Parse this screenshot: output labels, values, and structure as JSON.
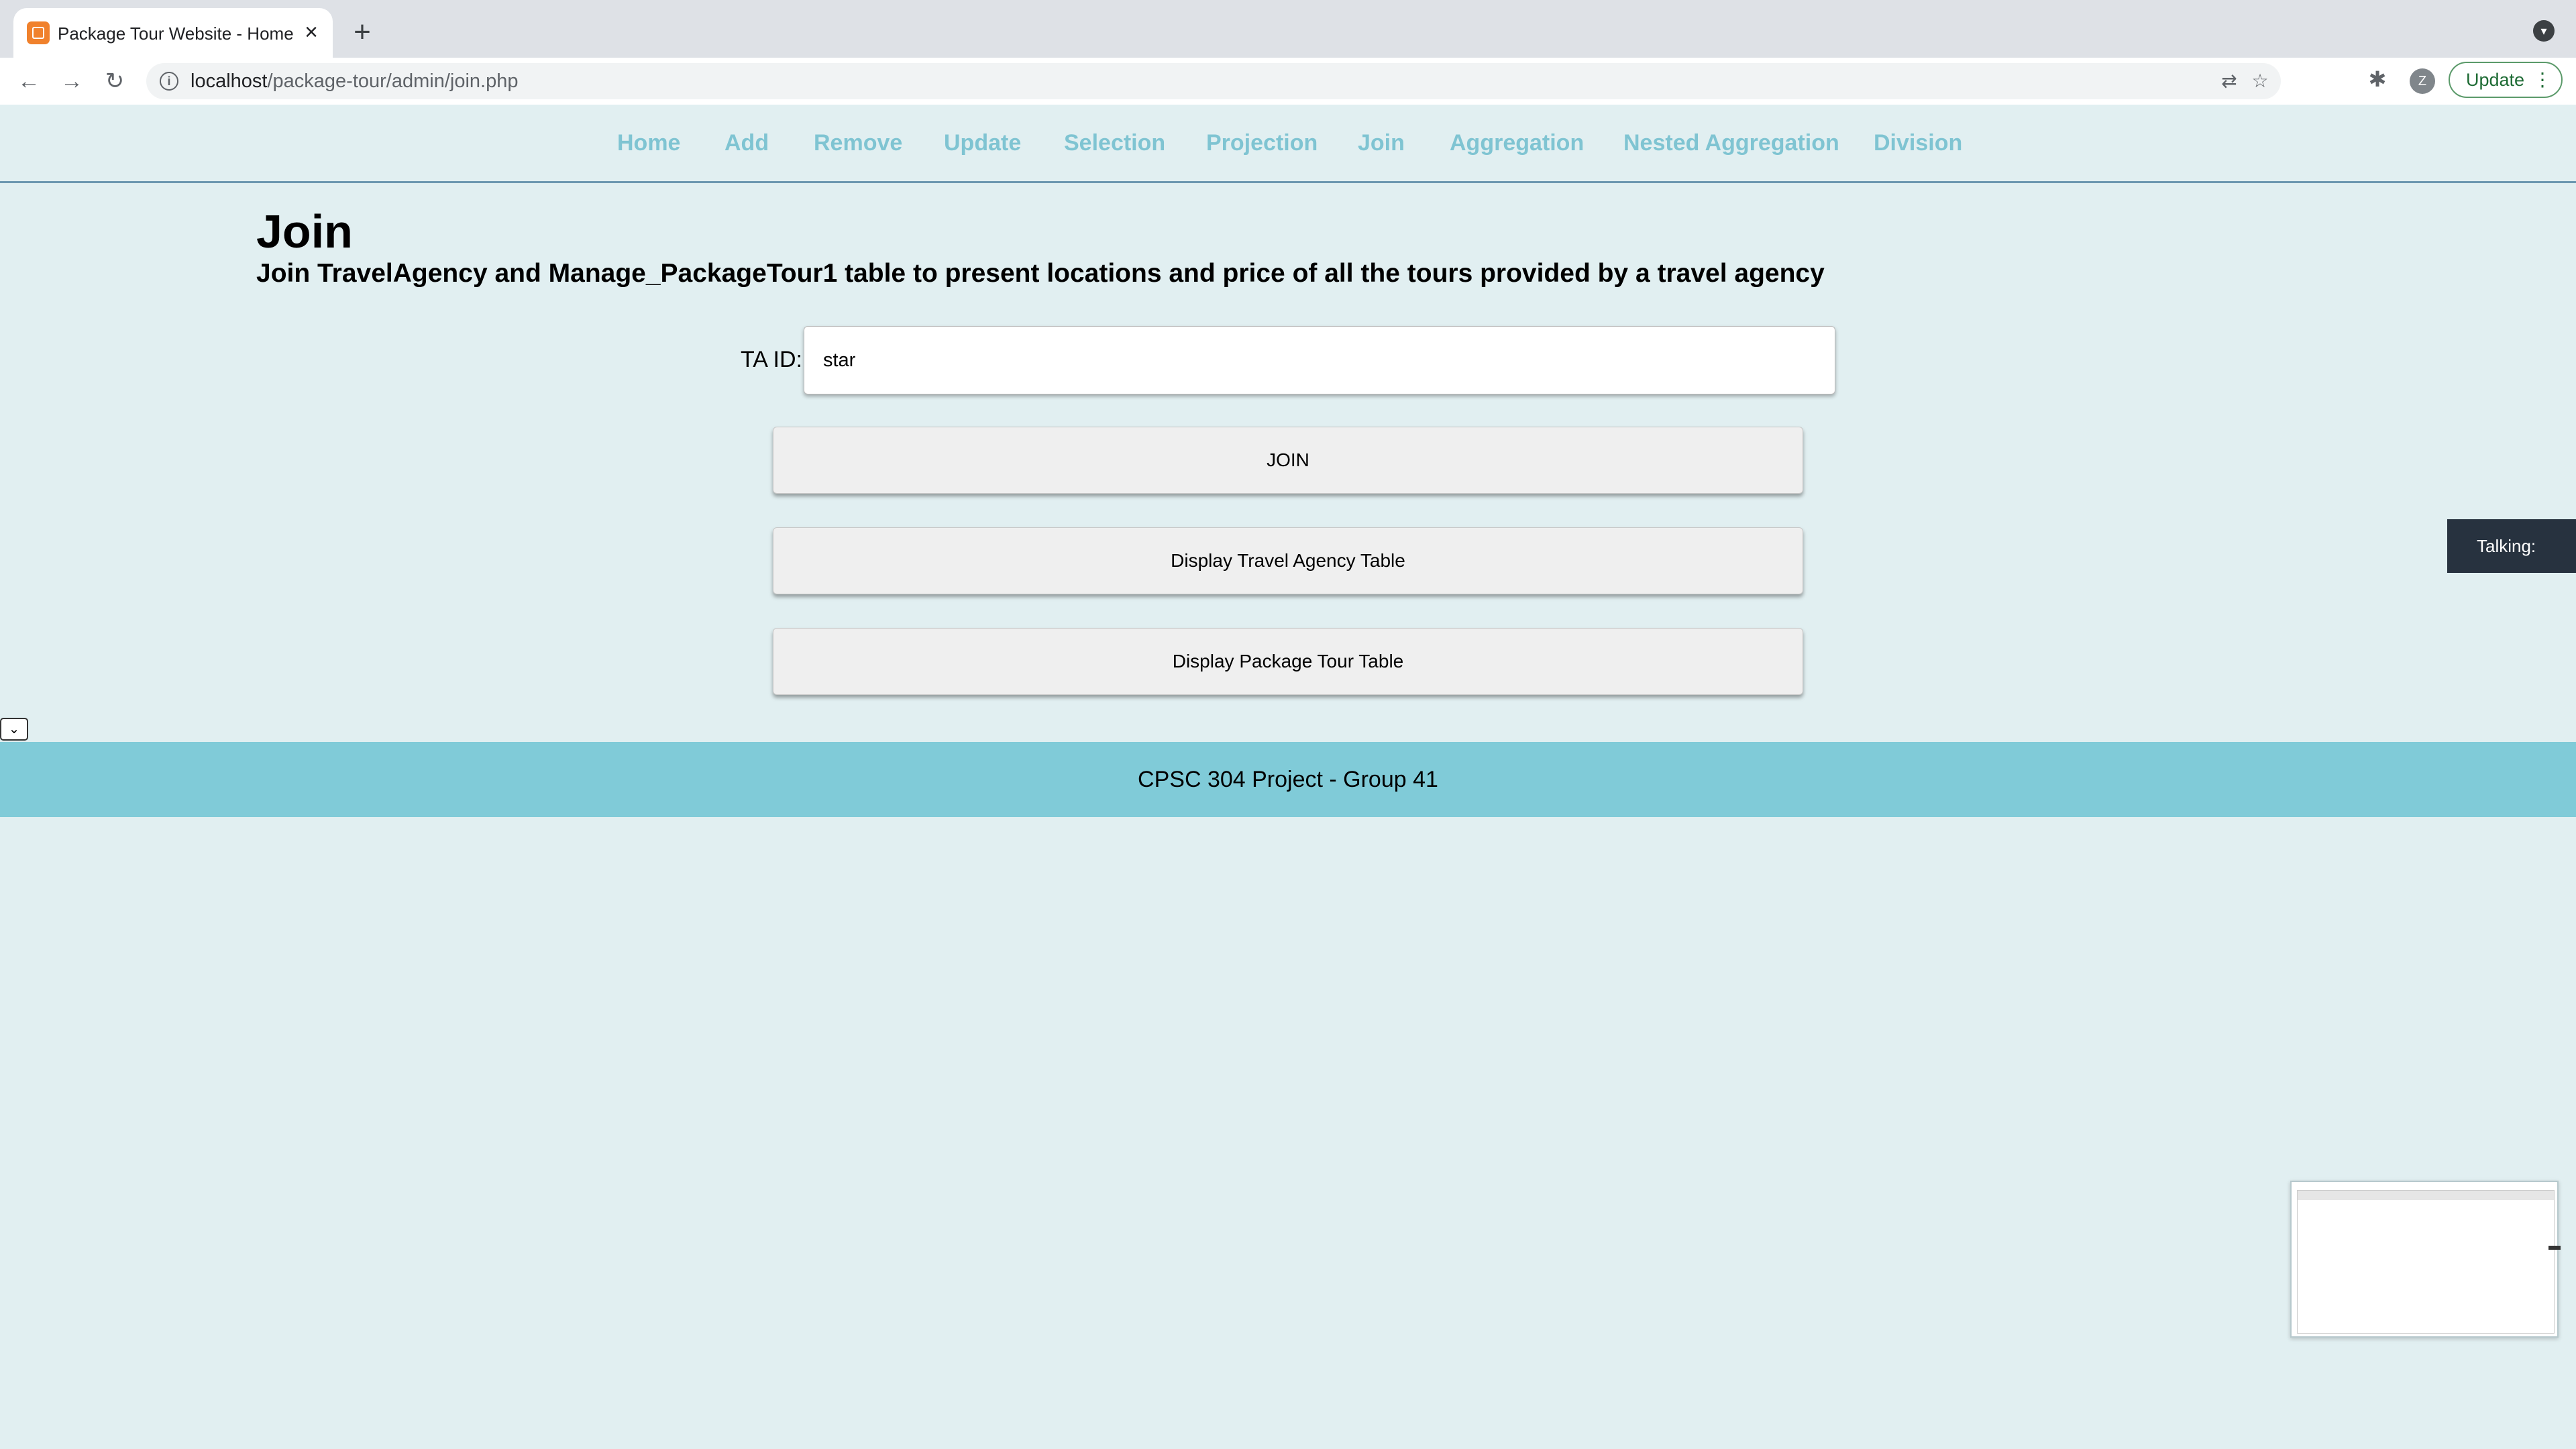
{
  "browser": {
    "tab_title": "Package Tour Website - Home",
    "tab_close": "×",
    "new_tab": "+",
    "url_host": "localhost",
    "url_path": "/package-tour/admin/join.php",
    "update_label": "Update",
    "profile_initial": "Z"
  },
  "nav": {
    "items": [
      {
        "label": "Home"
      },
      {
        "label": "Add"
      },
      {
        "label": "Remove"
      },
      {
        "label": "Update"
      },
      {
        "label": "Selection"
      },
      {
        "label": "Projection"
      },
      {
        "label": "Join"
      },
      {
        "label": "Aggregation"
      },
      {
        "label": "Nested Aggregation"
      },
      {
        "label": "Division"
      }
    ],
    "color": "#7fc4d2"
  },
  "page": {
    "title": "Join",
    "subtitle": "Join TravelAgency and Manage_PackageTour1 table to present locations and price of all the tours provided by a travel agency"
  },
  "form": {
    "ta_id_label": "TA ID:",
    "ta_id_value": "star",
    "join_button": "JOIN",
    "display_agency_button": "Display Travel Agency Table",
    "display_tour_button": "Display Package Tour Table"
  },
  "overlay": {
    "talking_label": "Talking:"
  },
  "footer": {
    "text": "CPSC 304 Project - Group 41",
    "color": "#80cbd8"
  }
}
